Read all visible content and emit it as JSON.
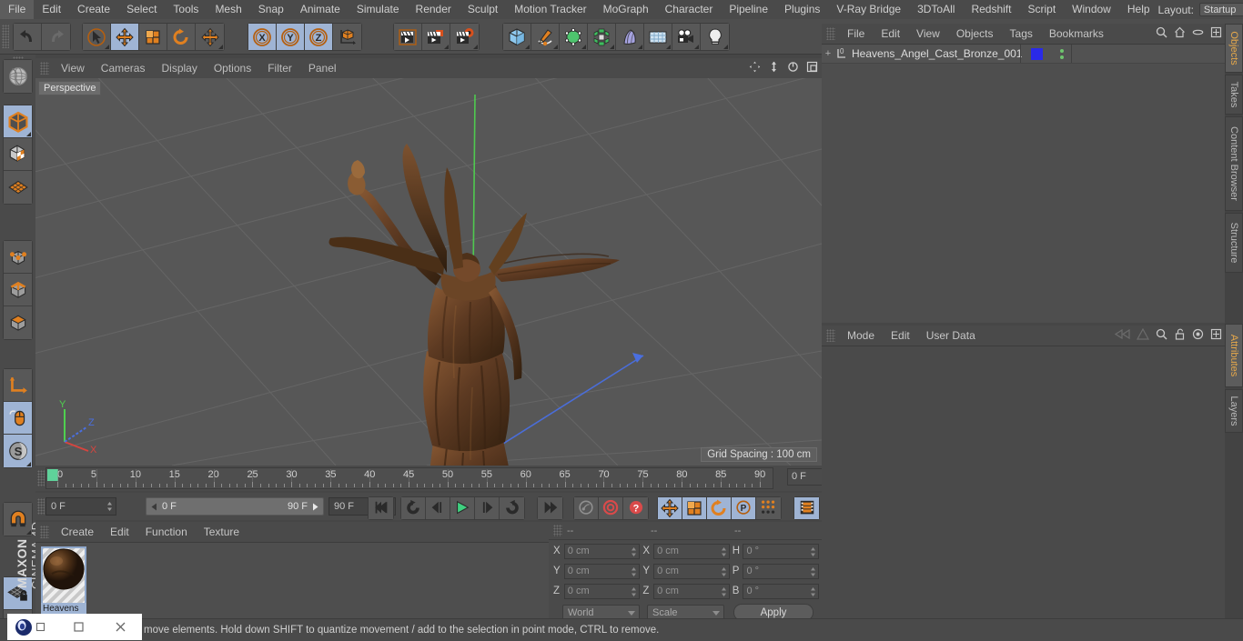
{
  "app": {
    "brand_line1": "MAXON",
    "brand_line2": "CINEMA 4D"
  },
  "menubar": {
    "items": [
      "File",
      "Edit",
      "Create",
      "Select",
      "Tools",
      "Mesh",
      "Snap",
      "Animate",
      "Simulate",
      "Render",
      "Sculpt",
      "Motion Tracker",
      "MoGraph",
      "Character",
      "Pipeline",
      "Plugins",
      "V-Ray Bridge",
      "3DToAll",
      "Redshift",
      "Script",
      "Window",
      "Help"
    ],
    "layout_label": "Layout:",
    "layout_value": "Startup",
    "icons": [
      "search-icon",
      "home-icon",
      "minimize-icon",
      "maximize-icon"
    ]
  },
  "toolbar": {
    "groups": [
      {
        "name": "undo-redo",
        "buttons": [
          {
            "name": "undo-button",
            "icon": "undo-arrow",
            "active": false,
            "corner": false
          },
          {
            "name": "redo-button",
            "icon": "redo-arrow",
            "active": false,
            "corner": false
          }
        ]
      },
      {
        "name": "tools",
        "buttons": [
          {
            "name": "live-selection-tool",
            "icon": "cursor-circle",
            "active": false,
            "corner": true
          },
          {
            "name": "move-tool",
            "icon": "move-cross",
            "active": true,
            "corner": false
          },
          {
            "name": "scale-tool",
            "icon": "scale-box",
            "active": false,
            "corner": false
          },
          {
            "name": "rotate-tool",
            "icon": "rotate-arc",
            "active": false,
            "corner": false
          },
          {
            "name": "move-alt-tool",
            "icon": "move-cross",
            "active": false,
            "corner": true
          }
        ]
      },
      {
        "name": "axis-locks",
        "buttons": [
          {
            "name": "lock-x-axis",
            "icon": "x-circle",
            "active": true,
            "corner": false
          },
          {
            "name": "lock-y-axis",
            "icon": "y-circle",
            "active": true,
            "corner": false
          },
          {
            "name": "lock-z-axis",
            "icon": "z-circle",
            "active": true,
            "corner": false
          },
          {
            "name": "world-object-coordinates",
            "icon": "world-axis-cube",
            "active": false,
            "corner": false
          }
        ]
      },
      {
        "name": "render",
        "buttons": [
          {
            "name": "render-view-button",
            "icon": "clapper-frame",
            "active": false,
            "corner": false
          },
          {
            "name": "render-to-picture-viewer-button",
            "icon": "clapper-picture",
            "active": false,
            "corner": true
          },
          {
            "name": "edit-render-settings-button",
            "icon": "clapper-gear",
            "active": false,
            "corner": true
          }
        ]
      },
      {
        "name": "create",
        "buttons": [
          {
            "name": "add-cube-object",
            "icon": "cube-blue",
            "active": false,
            "corner": true
          },
          {
            "name": "add-spline-object",
            "icon": "pen-spline",
            "active": false,
            "corner": true
          },
          {
            "name": "add-generator-object",
            "icon": "green-cube-cage",
            "active": false,
            "corner": true
          },
          {
            "name": "add-mograph-object",
            "icon": "green-cluster",
            "active": false,
            "corner": true
          },
          {
            "name": "add-deformer-object",
            "icon": "purple-bend",
            "active": false,
            "corner": true
          },
          {
            "name": "add-environment-object",
            "icon": "floor-grid",
            "active": false,
            "corner": true
          },
          {
            "name": "add-camera-object",
            "icon": "camera",
            "active": false,
            "corner": true
          },
          {
            "name": "add-light-object",
            "icon": "lightbulb",
            "active": false,
            "corner": true
          }
        ]
      }
    ]
  },
  "left_toolbar": {
    "groups": [
      {
        "name": "mode-top",
        "buttons": [
          {
            "name": "make-editable-button",
            "icon": "globe-mesh",
            "active": false,
            "corner": false
          }
        ]
      },
      {
        "name": "mode-object",
        "buttons": [
          {
            "name": "object-mode-button",
            "icon": "orange-cube",
            "active": true,
            "corner": true
          },
          {
            "name": "texture-mode-button",
            "icon": "checker-cube",
            "active": false,
            "corner": false
          },
          {
            "name": "deformer-mode-button",
            "icon": "orange-grid",
            "active": false,
            "corner": false
          }
        ]
      },
      {
        "name": "component-modes",
        "buttons": [
          {
            "name": "point-mode-button",
            "icon": "point-cube",
            "active": false,
            "corner": false
          },
          {
            "name": "edge-mode-button",
            "icon": "edge-cube",
            "active": false,
            "corner": false
          },
          {
            "name": "polygon-mode-button",
            "icon": "polygon-cube",
            "active": false,
            "corner": false
          }
        ]
      },
      {
        "name": "axis-group",
        "buttons": [
          {
            "name": "enable-axis-button",
            "icon": "axis-L",
            "active": false,
            "corner": false
          },
          {
            "name": "viewport-solo-button",
            "icon": "mouse-orange",
            "active": true,
            "corner": false
          },
          {
            "name": "soft-selection-button",
            "icon": "s-sphere",
            "active": true,
            "corner": true
          }
        ]
      },
      {
        "name": "snap-group",
        "buttons": [
          {
            "name": "magnet-tool-button",
            "icon": "magnet",
            "active": false,
            "corner": true
          }
        ]
      },
      {
        "name": "workplane-group",
        "buttons": [
          {
            "name": "lock-workplane-button",
            "icon": "grid-lock",
            "active": true,
            "corner": false
          },
          {
            "name": "planar-workplane-button",
            "icon": "grid-rotate",
            "active": false,
            "corner": true
          }
        ]
      }
    ]
  },
  "viewport": {
    "menu": [
      "View",
      "Cameras",
      "Display",
      "Options",
      "Filter",
      "Panel"
    ],
    "icons": [
      "pan-icon",
      "dolly-icon",
      "orbit-icon",
      "maximize-viewport-icon"
    ],
    "label": "Perspective",
    "grid_spacing": "Grid Spacing : 100 cm",
    "axis_gizmo": {
      "x_label": "X",
      "y_label": "Y",
      "z_label": "Z",
      "x_color": "#d6453f",
      "y_color": "#4fd04f",
      "z_color": "#4a6fe0"
    }
  },
  "timeline": {
    "tick_labels": [
      "0",
      "5",
      "10",
      "15",
      "20",
      "25",
      "30",
      "35",
      "40",
      "45",
      "50",
      "55",
      "60",
      "65",
      "70",
      "75",
      "80",
      "85",
      "90"
    ],
    "min_frame": 0,
    "max_frame": 90,
    "current_frame_field": "0 F"
  },
  "transport": {
    "current_frame": "0 F",
    "range_start": "0 F",
    "range_end": "90 F",
    "document_end": "90 F",
    "buttons": [
      {
        "name": "go-to-start-button",
        "icon": "skip-back",
        "active": false
      },
      {
        "name": "play-backwards-button",
        "icon": "rewind-loop",
        "active": false
      },
      {
        "name": "previous-frame-button",
        "icon": "step-back",
        "active": false
      },
      {
        "name": "play-button",
        "icon": "play-triangle",
        "active": false
      },
      {
        "name": "next-frame-button",
        "icon": "step-forward",
        "active": false
      },
      {
        "name": "play-forwards-button",
        "icon": "forward-loop",
        "active": false
      },
      {
        "name": "go-to-end-button",
        "icon": "skip-forward",
        "active": false
      },
      {
        "name": "record-active-objects-button",
        "icon": "key-grey",
        "active": false
      },
      {
        "name": "autokeying-button",
        "icon": "red-circle",
        "active": false
      },
      {
        "name": "keyframe-selection-button",
        "icon": "red-question",
        "active": false
      },
      {
        "name": "position-key-button",
        "icon": "move-cross",
        "active": true
      },
      {
        "name": "scale-key-button",
        "icon": "scale-box",
        "active": true
      },
      {
        "name": "rotation-key-button",
        "icon": "rotate-arc",
        "active": true
      },
      {
        "name": "parameter-key-button",
        "icon": "p-circle",
        "active": true
      },
      {
        "name": "point-level-animation-button",
        "icon": "dot-matrix",
        "active": false
      },
      {
        "name": "timeline-toggle-button",
        "icon": "film-strip",
        "active": true
      }
    ]
  },
  "material_manager": {
    "menu": [
      "Create",
      "Edit",
      "Function",
      "Texture"
    ],
    "materials": [
      {
        "name": "Heavens",
        "label": "Heavens"
      }
    ]
  },
  "coordinates_manager": {
    "header": [
      "--",
      "--",
      "--"
    ],
    "rows": [
      {
        "pos_label": "X",
        "pos_value": "0 cm",
        "size_label": "X",
        "size_value": "0 cm",
        "rot_label": "H",
        "rot_value": "0 °"
      },
      {
        "pos_label": "Y",
        "pos_value": "0 cm",
        "size_label": "Y",
        "size_value": "0 cm",
        "rot_label": "P",
        "rot_value": "0 °"
      },
      {
        "pos_label": "Z",
        "pos_value": "0 cm",
        "size_label": "Z",
        "size_value": "0 cm",
        "rot_label": "B",
        "rot_value": "0 °"
      }
    ],
    "coord_system": "World",
    "size_mode": "Scale",
    "apply_label": "Apply"
  },
  "object_manager": {
    "menu": [
      "File",
      "Edit",
      "View",
      "Objects",
      "Tags",
      "Bookmarks"
    ],
    "icons": [
      "search-icon",
      "home-icon",
      "ellipse-icon",
      "expand-icon"
    ],
    "rows": [
      {
        "name": "Heavens_Angel_Cast_Bronze_001",
        "tag_color": "#2a2ae8",
        "expandable": "+"
      }
    ]
  },
  "attributes_manager": {
    "menu": [
      "Mode",
      "Edit",
      "User Data"
    ],
    "icons": [
      "prev-icon",
      "next-icon",
      "search-icon",
      "lock-icon",
      "target-icon",
      "expand-icon"
    ]
  },
  "right_tabs": [
    {
      "label": "Objects",
      "active": true
    },
    {
      "label": "Takes",
      "active": false
    },
    {
      "label": "Content Browser",
      "active": false
    },
    {
      "label": "Structure",
      "active": false
    },
    {
      "label": "Attributes",
      "active": true
    },
    {
      "label": "Layers",
      "active": false
    }
  ],
  "status_bar": {
    "message": "move elements. Hold down SHIFT to quantize movement / add to the selection in point mode, CTRL to remove."
  },
  "taskbar": {
    "items": [
      "c4d-app-icon",
      "restore-window-icon",
      "minimize-window-icon",
      "close-window-icon"
    ]
  },
  "colors": {
    "accent_orange": "#e08020",
    "active_blue": "#9fb4d4",
    "panel_bg": "#4a4a4a",
    "viewport_bg": "#575757",
    "tab_orange": "#e6a84b"
  }
}
